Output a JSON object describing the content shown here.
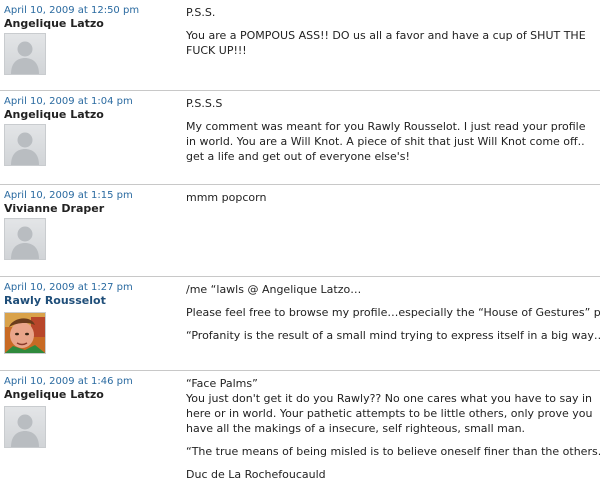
{
  "comments": [
    {
      "date": "April 10, 2009 at 12:50 pm",
      "author": "Angelique Latzo",
      "paragraphs": [
        "P.S.S.",
        "You are a POMPOUS ASS!! DO us all a favor and have a cup of SHUT THE FUCK UP!!!"
      ]
    },
    {
      "date": "April 10, 2009 at 1:04 pm",
      "author": "Angelique Latzo",
      "paragraphs": [
        "P.S.S.S",
        "My comment was meant for you Rawly Rousselot. I just read your profile in world. You are a Will Knot. A piece of shit that just Will Knot come off.. get a life and get out of everyone else's!"
      ]
    },
    {
      "date": "April 10, 2009 at 1:15 pm",
      "author": "Vivianne Draper",
      "paragraphs": [
        "mmm popcorn"
      ]
    },
    {
      "date": "April 10, 2009 at 1:27 pm",
      "author": "Rawly Rousselot",
      "paragraphs": [
        "/me “lawls @ Angelique Latzo…",
        "Please feel free to browse my profile…especially the “House of Gestures” pick…",
        "“Profanity is the result of a small mind trying to express itself in a big way…”"
      ]
    },
    {
      "date": "April 10, 2009 at 1:46 pm",
      "author": "Angelique Latzo",
      "paragraphs": [
        "“Face Palms”",
        "You just don't get it do you Rawly?? No one cares what you have to say in here or in world. Your pathetic attempts to be little others, only prove you have all the makings of a insecure, self righteous, small man.",
        "“The true means of being misled is to believe oneself finer than the others..”",
        "Duc de La Rochefoucauld"
      ]
    }
  ]
}
